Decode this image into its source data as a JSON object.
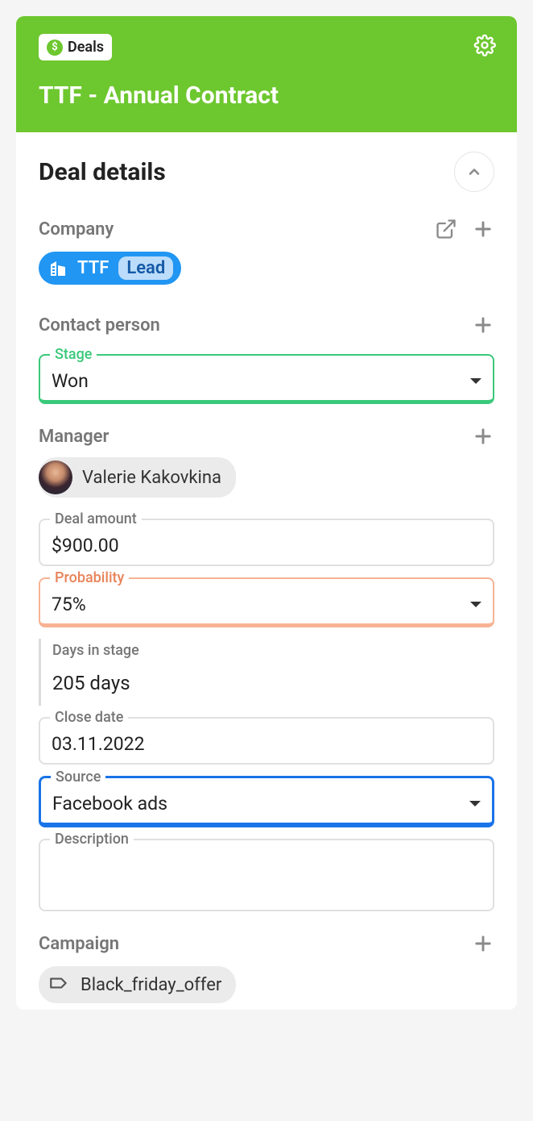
{
  "header": {
    "badge_label": "Deals",
    "title": "TTF - Annual Contract"
  },
  "section": {
    "title": "Deal details"
  },
  "company": {
    "label": "Company",
    "name": "TTF",
    "status": "Lead"
  },
  "contact": {
    "label": "Contact person"
  },
  "stage": {
    "label": "Stage",
    "value": "Won"
  },
  "manager": {
    "label": "Manager",
    "name": "Valerie Kakovkina"
  },
  "deal_amount": {
    "label": "Deal amount",
    "value": "$900.00"
  },
  "probability": {
    "label": "Probability",
    "value": "75%"
  },
  "days_in_stage": {
    "label": "Days in stage",
    "value": "205 days"
  },
  "close_date": {
    "label": "Close date",
    "value": "03.11.2022"
  },
  "source": {
    "label": "Source",
    "value": "Facebook ads"
  },
  "description": {
    "label": "Description",
    "value": ""
  },
  "campaign": {
    "label": "Campaign",
    "value": "Black_friday_offer"
  }
}
